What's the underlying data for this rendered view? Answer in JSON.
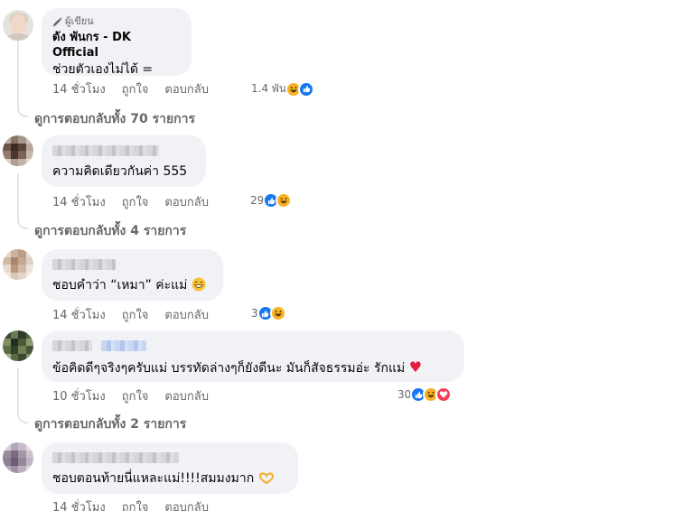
{
  "comments": [
    {
      "badge": "ผู้เขียน",
      "name": "ดัง พันกร - DK Official",
      "text": "ช่วยตัวเองไม่ได้ =",
      "time": "14 ชั่วโมง",
      "like_label": "ถูกใจ",
      "reply_label": "ตอบกลับ",
      "reaction_count": "1.4 พัน",
      "reactions": [
        "haha-icon",
        "like-icon"
      ],
      "view_replies": "ดูการตอบกลับทั้ง 70 รายการ"
    },
    {
      "text": "ความคิดเดียวกันค่า 555",
      "time": "14 ชั่วโมง",
      "like_label": "ถูกใจ",
      "reply_label": "ตอบกลับ",
      "reaction_count": "29",
      "reactions": [
        "like-icon",
        "haha-icon"
      ],
      "view_replies": "ดูการตอบกลับทั้ง 4 รายการ"
    },
    {
      "text": "ชอบคำว่า “เหมา” ค่ะแม่",
      "time": "14 ชั่วโมง",
      "like_label": "ถูกใจ",
      "reply_label": "ตอบกลับ",
      "reaction_count": "3",
      "reactions": [
        "like-icon",
        "haha-icon"
      ]
    },
    {
      "text": "ข้อคิดดีๆจริงๆครับแม่ บรรทัดล่างๆก็ยังดีนะ มันก็สัจธรรมอ่ะ รักแม่",
      "time": "10 ชั่วโมง",
      "like_label": "ถูกใจ",
      "reply_label": "ตอบกลับ",
      "reaction_count": "30",
      "reactions": [
        "like-icon",
        "haha-icon",
        "love-icon"
      ],
      "view_replies": "ดูการตอบกลับทั้ง 2 รายการ"
    },
    {
      "text": "ชอบตอนท้ายนี่แหละแม่!!!!สมมงมาก",
      "time": "14 ชั่วโมง",
      "like_label": "ถูกใจ",
      "reply_label": "ตอบกลับ"
    }
  ],
  "colors": {
    "like": "#1877f2",
    "haha": "#f7b125",
    "love": "#f33e58",
    "bubble": "#f0f2f5",
    "muted_text": "#65676b"
  }
}
